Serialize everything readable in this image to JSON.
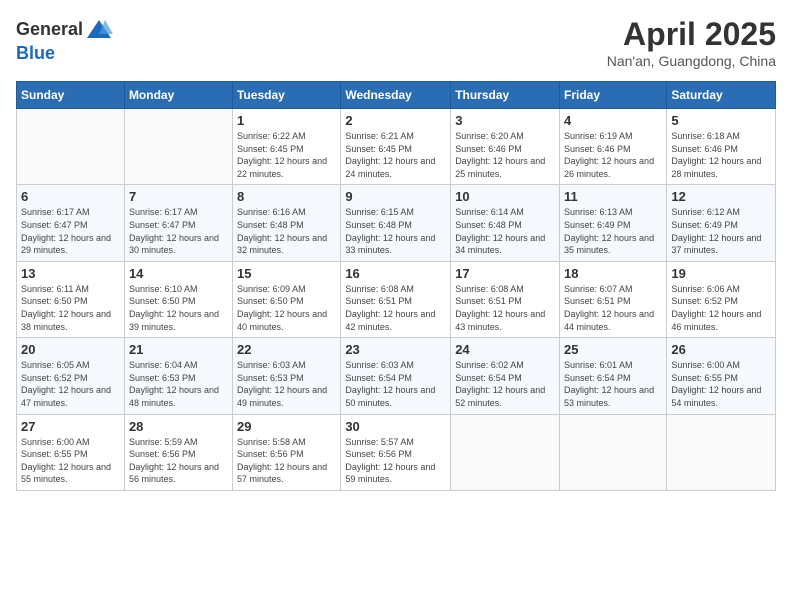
{
  "header": {
    "logo_line1": "General",
    "logo_line2": "Blue",
    "title": "April 2025",
    "location": "Nan'an, Guangdong, China"
  },
  "days_of_week": [
    "Sunday",
    "Monday",
    "Tuesday",
    "Wednesday",
    "Thursday",
    "Friday",
    "Saturday"
  ],
  "weeks": [
    [
      {
        "day": "",
        "sunrise": "",
        "sunset": "",
        "daylight": ""
      },
      {
        "day": "",
        "sunrise": "",
        "sunset": "",
        "daylight": ""
      },
      {
        "day": "1",
        "sunrise": "Sunrise: 6:22 AM",
        "sunset": "Sunset: 6:45 PM",
        "daylight": "Daylight: 12 hours and 22 minutes."
      },
      {
        "day": "2",
        "sunrise": "Sunrise: 6:21 AM",
        "sunset": "Sunset: 6:45 PM",
        "daylight": "Daylight: 12 hours and 24 minutes."
      },
      {
        "day": "3",
        "sunrise": "Sunrise: 6:20 AM",
        "sunset": "Sunset: 6:46 PM",
        "daylight": "Daylight: 12 hours and 25 minutes."
      },
      {
        "day": "4",
        "sunrise": "Sunrise: 6:19 AM",
        "sunset": "Sunset: 6:46 PM",
        "daylight": "Daylight: 12 hours and 26 minutes."
      },
      {
        "day": "5",
        "sunrise": "Sunrise: 6:18 AM",
        "sunset": "Sunset: 6:46 PM",
        "daylight": "Daylight: 12 hours and 28 minutes."
      }
    ],
    [
      {
        "day": "6",
        "sunrise": "Sunrise: 6:17 AM",
        "sunset": "Sunset: 6:47 PM",
        "daylight": "Daylight: 12 hours and 29 minutes."
      },
      {
        "day": "7",
        "sunrise": "Sunrise: 6:17 AM",
        "sunset": "Sunset: 6:47 PM",
        "daylight": "Daylight: 12 hours and 30 minutes."
      },
      {
        "day": "8",
        "sunrise": "Sunrise: 6:16 AM",
        "sunset": "Sunset: 6:48 PM",
        "daylight": "Daylight: 12 hours and 32 minutes."
      },
      {
        "day": "9",
        "sunrise": "Sunrise: 6:15 AM",
        "sunset": "Sunset: 6:48 PM",
        "daylight": "Daylight: 12 hours and 33 minutes."
      },
      {
        "day": "10",
        "sunrise": "Sunrise: 6:14 AM",
        "sunset": "Sunset: 6:48 PM",
        "daylight": "Daylight: 12 hours and 34 minutes."
      },
      {
        "day": "11",
        "sunrise": "Sunrise: 6:13 AM",
        "sunset": "Sunset: 6:49 PM",
        "daylight": "Daylight: 12 hours and 35 minutes."
      },
      {
        "day": "12",
        "sunrise": "Sunrise: 6:12 AM",
        "sunset": "Sunset: 6:49 PM",
        "daylight": "Daylight: 12 hours and 37 minutes."
      }
    ],
    [
      {
        "day": "13",
        "sunrise": "Sunrise: 6:11 AM",
        "sunset": "Sunset: 6:50 PM",
        "daylight": "Daylight: 12 hours and 38 minutes."
      },
      {
        "day": "14",
        "sunrise": "Sunrise: 6:10 AM",
        "sunset": "Sunset: 6:50 PM",
        "daylight": "Daylight: 12 hours and 39 minutes."
      },
      {
        "day": "15",
        "sunrise": "Sunrise: 6:09 AM",
        "sunset": "Sunset: 6:50 PM",
        "daylight": "Daylight: 12 hours and 40 minutes."
      },
      {
        "day": "16",
        "sunrise": "Sunrise: 6:08 AM",
        "sunset": "Sunset: 6:51 PM",
        "daylight": "Daylight: 12 hours and 42 minutes."
      },
      {
        "day": "17",
        "sunrise": "Sunrise: 6:08 AM",
        "sunset": "Sunset: 6:51 PM",
        "daylight": "Daylight: 12 hours and 43 minutes."
      },
      {
        "day": "18",
        "sunrise": "Sunrise: 6:07 AM",
        "sunset": "Sunset: 6:51 PM",
        "daylight": "Daylight: 12 hours and 44 minutes."
      },
      {
        "day": "19",
        "sunrise": "Sunrise: 6:06 AM",
        "sunset": "Sunset: 6:52 PM",
        "daylight": "Daylight: 12 hours and 46 minutes."
      }
    ],
    [
      {
        "day": "20",
        "sunrise": "Sunrise: 6:05 AM",
        "sunset": "Sunset: 6:52 PM",
        "daylight": "Daylight: 12 hours and 47 minutes."
      },
      {
        "day": "21",
        "sunrise": "Sunrise: 6:04 AM",
        "sunset": "Sunset: 6:53 PM",
        "daylight": "Daylight: 12 hours and 48 minutes."
      },
      {
        "day": "22",
        "sunrise": "Sunrise: 6:03 AM",
        "sunset": "Sunset: 6:53 PM",
        "daylight": "Daylight: 12 hours and 49 minutes."
      },
      {
        "day": "23",
        "sunrise": "Sunrise: 6:03 AM",
        "sunset": "Sunset: 6:54 PM",
        "daylight": "Daylight: 12 hours and 50 minutes."
      },
      {
        "day": "24",
        "sunrise": "Sunrise: 6:02 AM",
        "sunset": "Sunset: 6:54 PM",
        "daylight": "Daylight: 12 hours and 52 minutes."
      },
      {
        "day": "25",
        "sunrise": "Sunrise: 6:01 AM",
        "sunset": "Sunset: 6:54 PM",
        "daylight": "Daylight: 12 hours and 53 minutes."
      },
      {
        "day": "26",
        "sunrise": "Sunrise: 6:00 AM",
        "sunset": "Sunset: 6:55 PM",
        "daylight": "Daylight: 12 hours and 54 minutes."
      }
    ],
    [
      {
        "day": "27",
        "sunrise": "Sunrise: 6:00 AM",
        "sunset": "Sunset: 6:55 PM",
        "daylight": "Daylight: 12 hours and 55 minutes."
      },
      {
        "day": "28",
        "sunrise": "Sunrise: 5:59 AM",
        "sunset": "Sunset: 6:56 PM",
        "daylight": "Daylight: 12 hours and 56 minutes."
      },
      {
        "day": "29",
        "sunrise": "Sunrise: 5:58 AM",
        "sunset": "Sunset: 6:56 PM",
        "daylight": "Daylight: 12 hours and 57 minutes."
      },
      {
        "day": "30",
        "sunrise": "Sunrise: 5:57 AM",
        "sunset": "Sunset: 6:56 PM",
        "daylight": "Daylight: 12 hours and 59 minutes."
      },
      {
        "day": "",
        "sunrise": "",
        "sunset": "",
        "daylight": ""
      },
      {
        "day": "",
        "sunrise": "",
        "sunset": "",
        "daylight": ""
      },
      {
        "day": "",
        "sunrise": "",
        "sunset": "",
        "daylight": ""
      }
    ]
  ]
}
